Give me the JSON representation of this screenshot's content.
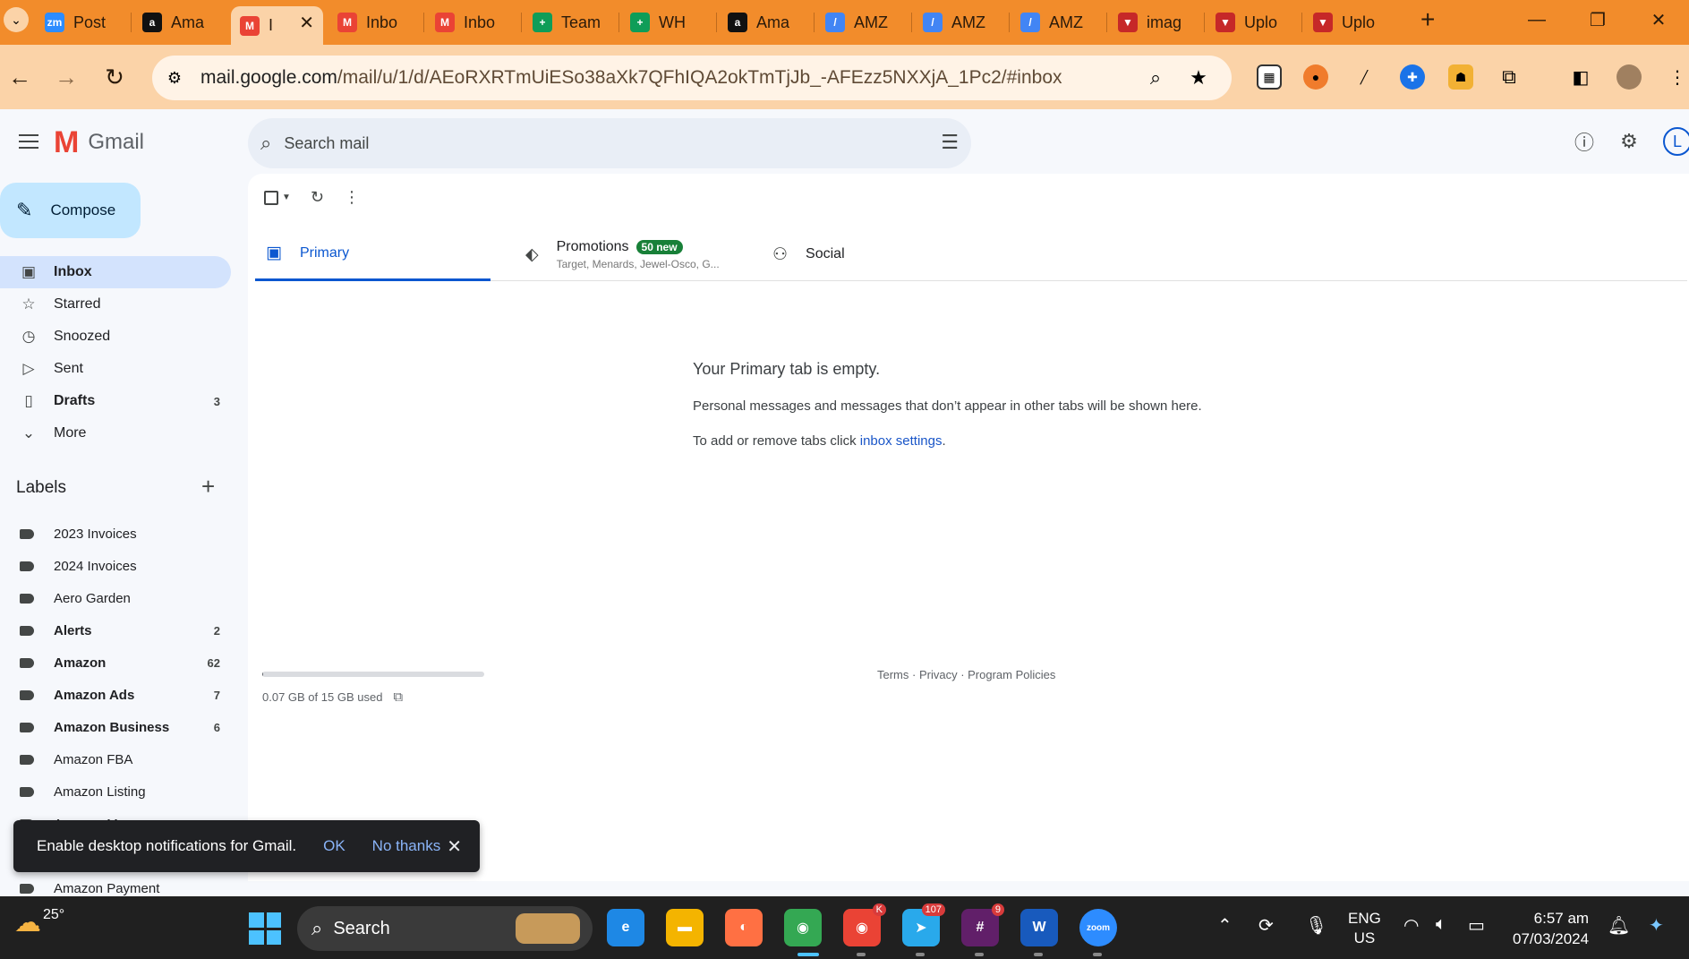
{
  "browser": {
    "tabs": [
      {
        "label": "Post",
        "fav": "zm",
        "color": "#2d8cff"
      },
      {
        "label": "Ama",
        "fav": "a",
        "color": "#111111"
      },
      {
        "label": "I",
        "fav": "M",
        "color": "#ea4335",
        "active": true
      },
      {
        "label": "Inbo",
        "fav": "M",
        "color": "#ea4335"
      },
      {
        "label": "Inbo",
        "fav": "M",
        "color": "#ea4335"
      },
      {
        "label": "Team",
        "fav": "+",
        "color": "#0f9d58"
      },
      {
        "label": "WH",
        "fav": "+",
        "color": "#0f9d58"
      },
      {
        "label": "Ama",
        "fav": "a",
        "color": "#111111"
      },
      {
        "label": "AMZ",
        "fav": "/",
        "color": "#4285f4"
      },
      {
        "label": "AMZ",
        "fav": "/",
        "color": "#4285f4"
      },
      {
        "label": "AMZ",
        "fav": "/",
        "color": "#4285f4"
      },
      {
        "label": "imag",
        "fav": "▼",
        "color": "#c62828"
      },
      {
        "label": "Uplo",
        "fav": "▼",
        "color": "#c62828"
      },
      {
        "label": "Uplo",
        "fav": "▼",
        "color": "#c62828"
      }
    ],
    "new_tab": "+",
    "url_domain": "mail.google.com",
    "url_path": "/mail/u/1/d/AEoRXRTmUiESo38aXk7QFhIQA2okTmTjJb_-AFEzz5NXXjA_1Pc2/#inbox",
    "theme_color": "#f28c2b"
  },
  "gmail": {
    "product_name": "Gmail",
    "search_placeholder": "Search mail",
    "compose_label": "Compose",
    "nav": [
      {
        "label": "Inbox",
        "icon": "inbox-icon",
        "glyph": "▣",
        "count": "",
        "active": true
      },
      {
        "label": "Starred",
        "icon": "star-icon",
        "glyph": "☆",
        "count": ""
      },
      {
        "label": "Snoozed",
        "icon": "clock-icon",
        "glyph": "◷",
        "count": ""
      },
      {
        "label": "Sent",
        "icon": "send-icon",
        "glyph": "▷",
        "count": ""
      },
      {
        "label": "Drafts",
        "icon": "draft-icon",
        "glyph": "▯",
        "count": "3",
        "bold": true
      },
      {
        "label": "More",
        "icon": "chevron-down-icon",
        "glyph": "⌄",
        "count": ""
      }
    ],
    "labels_title": "Labels",
    "labels": [
      {
        "name": "2023 Invoices",
        "count": ""
      },
      {
        "name": "2024 Invoices",
        "count": ""
      },
      {
        "name": "Aero Garden",
        "count": ""
      },
      {
        "name": "Alerts",
        "count": "2",
        "bold": true
      },
      {
        "name": "Amazon",
        "count": "62",
        "bold": true
      },
      {
        "name": "Amazon Ads",
        "count": "7",
        "bold": true
      },
      {
        "name": "Amazon Business",
        "count": "6",
        "bold": true
      },
      {
        "name": "Amazon FBA",
        "count": ""
      },
      {
        "name": "Amazon Listing",
        "count": ""
      },
      {
        "name": "Amazon Message",
        "count": ""
      },
      {
        "name": "",
        "count": ""
      },
      {
        "name": "Amazon Payment",
        "count": ""
      }
    ],
    "inbox_tabs": {
      "primary": "Primary",
      "promotions": "Promotions",
      "promotions_badge": "50 new",
      "promotions_senders": "Target, Menards, Jewel-Osco, G...",
      "social": "Social"
    },
    "empty_state": {
      "title": "Your Primary tab is empty.",
      "description": "Personal messages and messages that don’t appear in other tabs will be shown here.",
      "settings_prefix": "To add or remove tabs click ",
      "settings_link": "inbox settings",
      "settings_suffix": "."
    },
    "storage": {
      "text": "0.07 GB of 15 GB used",
      "used_fraction": 0.005
    },
    "footer": {
      "terms": "Terms",
      "privacy": "Privacy",
      "policies": "Program Policies",
      "sep": " · "
    },
    "snackbar": {
      "message": "Enable desktop notifications for Gmail.",
      "ok": "OK",
      "no_thanks": "No thanks"
    }
  },
  "taskbar": {
    "temperature": "25°",
    "search_label": "Search",
    "apps": [
      {
        "name": "edge-app",
        "glyph": "e",
        "color": "#1e88e5",
        "badge": ""
      },
      {
        "name": "file-explorer-app",
        "glyph": "▬",
        "color": "#f4b400",
        "badge": ""
      },
      {
        "name": "vpn-app",
        "glyph": "◐",
        "color": "#ff7043",
        "badge": ""
      },
      {
        "name": "chrome-app",
        "glyph": "◉",
        "color": "#34a853",
        "badge": ""
      },
      {
        "name": "chrome-profile-app",
        "glyph": "◉",
        "color": "#ea4335",
        "badge": "K"
      },
      {
        "name": "telegram-app",
        "glyph": "➤",
        "color": "#29a9eb",
        "badge": "107"
      },
      {
        "name": "slack-app",
        "glyph": "#",
        "color": "#611f69",
        "badge": "9"
      },
      {
        "name": "word-app",
        "glyph": "W",
        "color": "#185abd",
        "badge": ""
      },
      {
        "name": "zoom-app",
        "glyph": "zoom",
        "color": "#2d8cff",
        "badge": ""
      }
    ],
    "lang_top": "ENG",
    "lang_bottom": "US",
    "time": "6:57 am",
    "date": "07/03/2024"
  }
}
